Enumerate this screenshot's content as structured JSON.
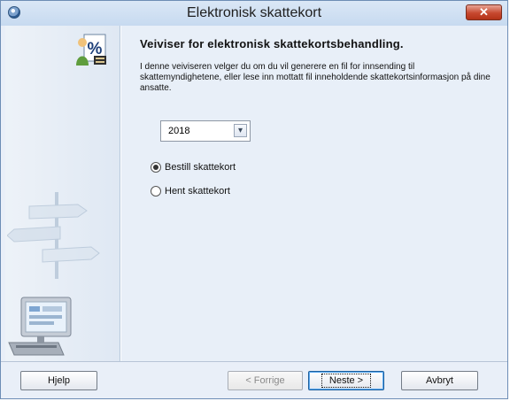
{
  "window": {
    "title": "Elektronisk skattekort",
    "close_glyph": "✕"
  },
  "main": {
    "heading": "Veiviser for elektronisk skattekortsbehandling.",
    "description": "I denne veiviseren velger du om du vil generere en fil for innsending til skattemyndighetene, eller lese inn mottatt fil inneholdende skattekortsinformasjon på dine ansatte.",
    "year_select": {
      "value": "2018"
    },
    "options": [
      {
        "label": "Bestill skattekort",
        "selected": true
      },
      {
        "label": "Hent skattekort",
        "selected": false
      }
    ]
  },
  "buttons": {
    "help": "Hjelp",
    "back": "< Forrige",
    "next": "Neste >",
    "cancel": "Avbryt"
  },
  "icons": {
    "app": "app-icon",
    "wizard": "tax-card-person-icon",
    "side_signpost": "signpost-icon",
    "side_computer": "computer-icon"
  }
}
